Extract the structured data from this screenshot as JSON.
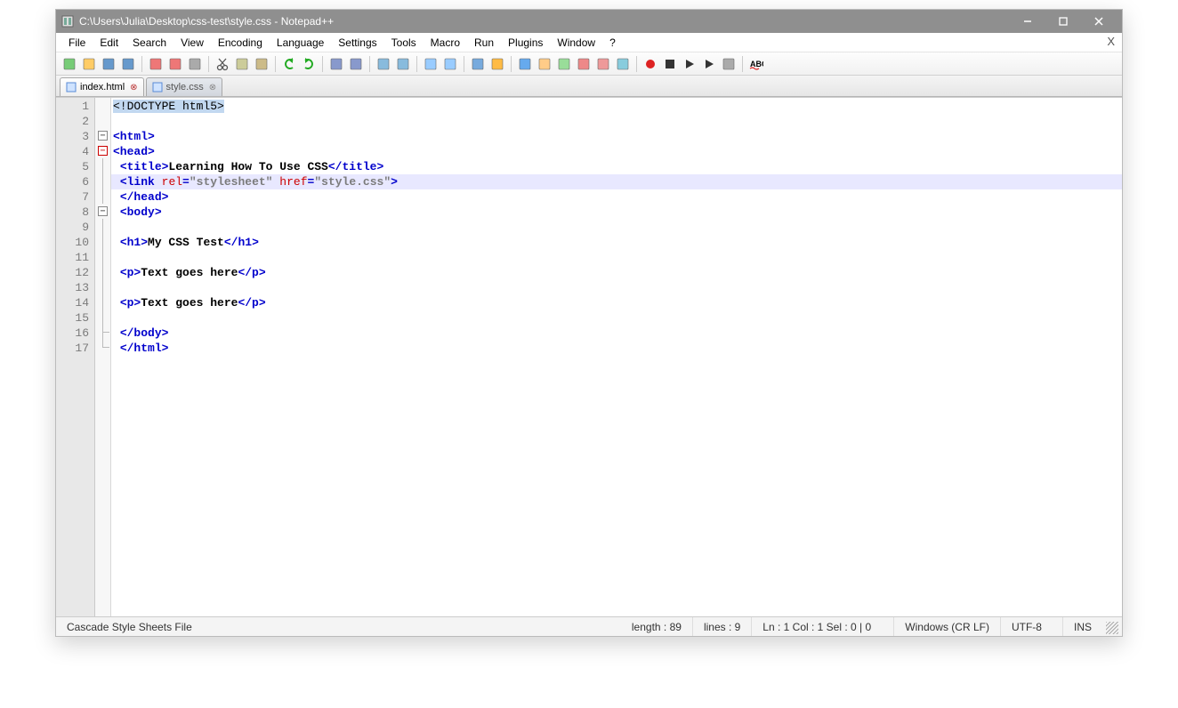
{
  "window": {
    "title": "C:\\Users\\Julia\\Desktop\\css-test\\style.css - Notepad++"
  },
  "menus": [
    "File",
    "Edit",
    "Search",
    "View",
    "Encoding",
    "Language",
    "Settings",
    "Tools",
    "Macro",
    "Run",
    "Plugins",
    "Window",
    "?"
  ],
  "close_doc_x": "X",
  "tabs": [
    {
      "label": "index.html",
      "active": true
    },
    {
      "label": "style.css",
      "active": false
    }
  ],
  "code_lines": [
    {
      "n": 1,
      "html": "<span class='t-sel'>&lt;!DOCTYPE html5&gt;</span>"
    },
    {
      "n": 2,
      "html": ""
    },
    {
      "n": 3,
      "html": "<span class='t-tag'>&lt;html&gt;</span>"
    },
    {
      "n": 4,
      "html": "<span class='t-tag'>&lt;head&gt;</span>"
    },
    {
      "n": 5,
      "html": "<span class='t-tag'>&lt;title&gt;</span><span class='t-txt'>Learning How To Use CSS</span><span class='t-tag'>&lt;/title&gt;</span>"
    },
    {
      "n": 6,
      "html": "<span class='t-tag'>&lt;link</span> <span class='t-attr'>rel</span><span class='t-tag'>=</span><span class='t-str'>\"stylesheet\"</span> <span class='t-attr'>href</span><span class='t-tag'>=</span><span class='t-str'>\"style.css\"</span><span class='t-tag'>&gt;</span>"
    },
    {
      "n": 7,
      "html": "<span class='t-tag'>&lt;/head&gt;</span>"
    },
    {
      "n": 8,
      "html": "<span class='t-tag'>&lt;body&gt;</span>"
    },
    {
      "n": 9,
      "html": ""
    },
    {
      "n": 10,
      "html": "<span class='t-tag'>&lt;h1&gt;</span><span class='t-txt'>My CSS Test</span><span class='t-tag'>&lt;/h1&gt;</span>"
    },
    {
      "n": 11,
      "html": ""
    },
    {
      "n": 12,
      "html": "<span class='t-tag'>&lt;p&gt;</span><span class='t-txt'>Text goes here</span><span class='t-tag'>&lt;/p&gt;</span>"
    },
    {
      "n": 13,
      "html": ""
    },
    {
      "n": 14,
      "html": "<span class='t-tag'>&lt;p&gt;</span><span class='t-txt'>Text goes here</span><span class='t-tag'>&lt;/p&gt;</span>"
    },
    {
      "n": 15,
      "html": ""
    },
    {
      "n": 16,
      "html": "<span class='t-tag'>&lt;/body&gt;</span>"
    },
    {
      "n": 17,
      "html": "<span class='t-tag'>&lt;/html&gt;</span>"
    }
  ],
  "line_indents": {
    "5": 1,
    "6": 1,
    "7": 1,
    "8": 1,
    "9": 1,
    "10": 1,
    "11": 1,
    "12": 1,
    "13": 1,
    "14": 1,
    "15": 1,
    "16": 1,
    "17": 1
  },
  "highlight_line": 6,
  "fold": {
    "3": {
      "box": "minus"
    },
    "4": {
      "box": "minus-red"
    },
    "5": {
      "line": true
    },
    "6": {
      "line": true
    },
    "7": {
      "line": true,
      "corner": false
    },
    "8": {
      "box": "minus"
    },
    "9": {
      "line": true
    },
    "10": {
      "line": true
    },
    "11": {
      "line": true
    },
    "12": {
      "line": true
    },
    "13": {
      "line": true
    },
    "14": {
      "line": true
    },
    "15": {
      "line": true
    },
    "16": {
      "line": true,
      "corner": true
    },
    "17": {
      "line": false,
      "corner": true
    }
  },
  "status": {
    "filetype": "Cascade Style Sheets File",
    "length": "length : 89",
    "lines": "lines : 9",
    "pos": "Ln : 1   Col : 1   Sel : 0 | 0",
    "eol": "Windows (CR LF)",
    "enc": "UTF-8",
    "ins": "INS"
  },
  "toolbar_icons": [
    "new-file-icon",
    "open-file-icon",
    "save-icon",
    "save-all-icon",
    "sep",
    "close-file-icon",
    "close-all-icon",
    "print-icon",
    "sep",
    "cut-icon",
    "copy-icon",
    "paste-icon",
    "sep",
    "undo-icon",
    "redo-icon",
    "sep",
    "find-icon",
    "replace-icon",
    "sep",
    "zoom-in-icon",
    "zoom-out-icon",
    "sep",
    "sync-v-icon",
    "sync-h-icon",
    "sep",
    "wrap-icon",
    "all-chars-icon",
    "sep",
    "indent-guide-icon",
    "lang-icon",
    "doc-map-icon",
    "func-list-icon",
    "folder-icon",
    "monitor-icon",
    "sep",
    "record-macro-icon",
    "stop-macro-icon",
    "play-macro-icon",
    "play-multi-icon",
    "save-macro-icon",
    "sep",
    "spellcheck-icon"
  ]
}
